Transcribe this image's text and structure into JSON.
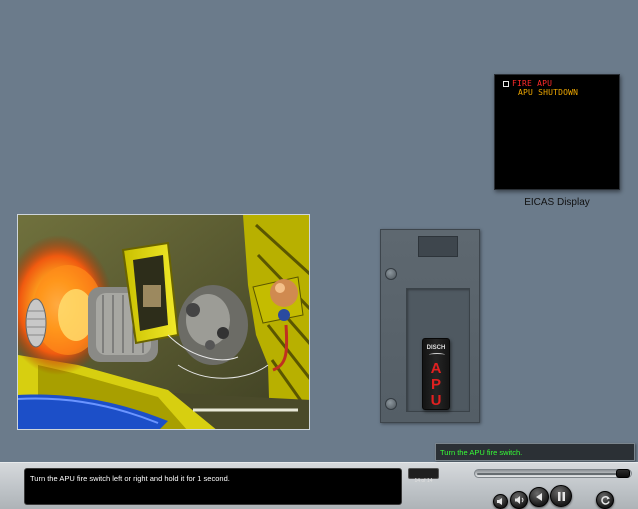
{
  "eicas": {
    "caption": "EICAS Display",
    "messages": [
      {
        "text": "FIRE APU",
        "color": "#ff2a2a"
      },
      {
        "text": "APU SHUTDOWN",
        "color": "#f0a800"
      }
    ]
  },
  "fire_switch": {
    "top_label": "DISCH",
    "letters": [
      "A",
      "P",
      "U"
    ]
  },
  "instruction_box": {
    "text": "Turn the APU fire switch."
  },
  "caption_box": {
    "text": "Turn the APU fire switch left or right and hold it for 1 second."
  },
  "player": {
    "page_counter": "14 of 14",
    "progress": 1.0,
    "buttons": [
      "volume-down-icon",
      "volume-up-icon",
      "back-icon",
      "pause-icon",
      "replay-icon"
    ]
  },
  "colors": {
    "background": "#6b7b8b",
    "eicas_warning": "#ff2a2a",
    "eicas_caution": "#f0a800",
    "instruction_text": "#36ff36"
  }
}
